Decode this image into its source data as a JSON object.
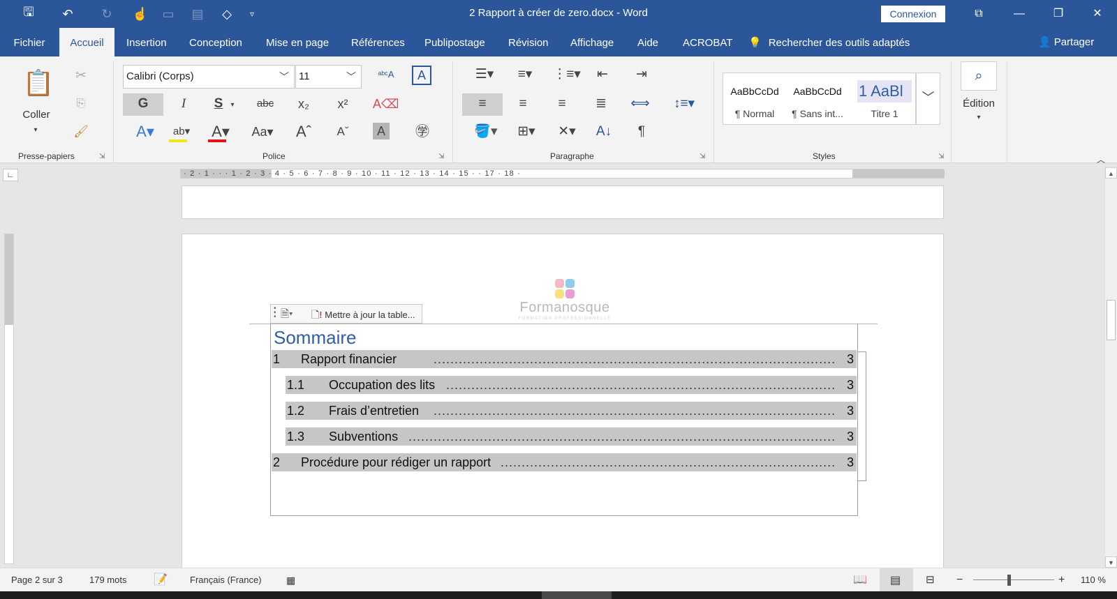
{
  "window": {
    "title": "2 Rapport à créer de zero.docx  -  Word",
    "connexion_label": "Connexion"
  },
  "tabs": [
    {
      "label": "Fichier"
    },
    {
      "label": "Accueil"
    },
    {
      "label": "Insertion"
    },
    {
      "label": "Conception"
    },
    {
      "label": "Mise en page"
    },
    {
      "label": "Références"
    },
    {
      "label": "Publipostage"
    },
    {
      "label": "Révision"
    },
    {
      "label": "Affichage"
    },
    {
      "label": "Aide"
    },
    {
      "label": "ACROBAT"
    }
  ],
  "search_tools": "Rechercher des outils adaptés",
  "share_label": "Partager",
  "ribbon": {
    "clipboard": {
      "paste_label": "Coller",
      "group_label": "Presse-papiers"
    },
    "font": {
      "name": "Calibri (Corps)",
      "size": "11",
      "group_label": "Police",
      "bold": "G",
      "italic": "I",
      "underline": "S",
      "strike": "abc",
      "case": "Aa"
    },
    "paragraph": {
      "group_label": "Paragraphe"
    },
    "styles": {
      "group_label": "Styles",
      "items": [
        {
          "sample": "AaBbCcDd",
          "name": "¶ Normal"
        },
        {
          "sample": "AaBbCcDd",
          "name": "¶ Sans int..."
        },
        {
          "sample": "1  AaBl",
          "name": "Titre 1"
        }
      ]
    },
    "editing": {
      "label": "Édition"
    }
  },
  "ruler": {
    "labels": "· 2 · 1 ·  ·  · 1 · 2 · 3 · 4 · 5 · 6 · 7 · 8 · 9 · 10 · 11 · 12 · 13 · 14 · 15 ·  · 17 · 18 ·"
  },
  "document": {
    "logo": {
      "word": "Formanosque",
      "tagline": "FORMATION PROFESSIONNELLE"
    },
    "toc_toolbar": {
      "update_label": "Mettre à jour la table..."
    },
    "toc": {
      "heading": "Sommaire",
      "entries": [
        {
          "num": "1",
          "title": "Rapport financier",
          "page": "3"
        },
        {
          "num": "1.1",
          "title": "Occupation des lits",
          "page": "3"
        },
        {
          "num": "1.2",
          "title": "Frais d’entretien",
          "page": "3"
        },
        {
          "num": "1.3",
          "title": "Subventions",
          "page": "3"
        },
        {
          "num": "2",
          "title": "Procédure pour rédiger un rapport",
          "page": "3"
        }
      ]
    }
  },
  "status": {
    "page": "Page 2 sur 3",
    "words": "179 mots",
    "language": "Français (France)",
    "zoom": "110 %"
  },
  "colors": {
    "accent": "#2b579a",
    "heading": "#2e5fa6"
  }
}
